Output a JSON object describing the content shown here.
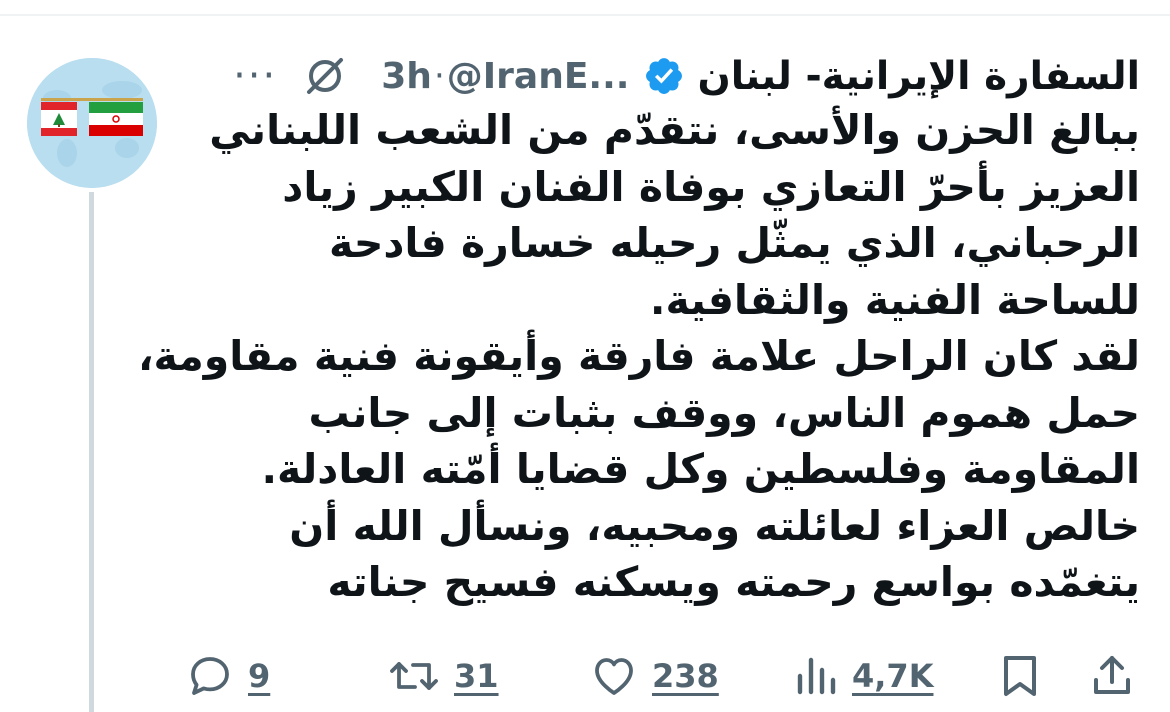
{
  "tweet": {
    "display_name": "السفارة الإيرانية- لبنان",
    "handle": "@IranE...",
    "separator": "·",
    "time": "3h",
    "more_icon": "more-dots-icon",
    "body_lines": [
      "ببالغ الحزن والأسى، نتقدّم من الشعب اللبناني",
      "العزيز بأحرّ التعازي بوفاة الفنان الكبير زياد",
      "الرحباني، الذي يمثّل رحيله خسارة فادحة",
      "للساحة الفنية والثقافية.",
      "لقد كان الراحل علامة فارقة وأيقونة فنية مقاومة،",
      "حمل هموم الناس، ووقف بثبات إلى جانب",
      "المقاومة وفلسطين وكل قضايا أمّته العادلة.",
      "خالص العزاء لعائلته ومحبيه، ونسأل الله أن",
      "يتغمّده بواسع رحمته ويسكنه فسيح جناته"
    ],
    "stats": {
      "replies": "9",
      "retweets": "31",
      "likes": "238",
      "views": "4,7K"
    }
  },
  "colors": {
    "accent": "#1d9bf0",
    "secondary_text": "#536471",
    "primary_text": "#0f1419",
    "avatar_bg": "#b9def0",
    "thread_line": "#cfd9de"
  }
}
